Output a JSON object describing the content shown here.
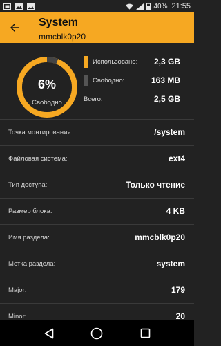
{
  "status_bar": {
    "battery": "40%",
    "time": "21:55",
    "icons": [
      "screenshot-icon",
      "gallery-icon",
      "image-icon",
      "wifi-icon",
      "signal-icon",
      "battery-icon"
    ]
  },
  "toolbar": {
    "title": "System",
    "subtitle": "mmcblk0p20",
    "back_icon": "arrow-left-icon",
    "color": "#f6a822"
  },
  "summary": {
    "used_percent": 6,
    "gauge_percent_text": "6%",
    "gauge_label": "Свободно",
    "legend": [
      {
        "label": "Использовано:",
        "value": "2,3 GB",
        "color": "#f6a822"
      },
      {
        "label": "Свободно:",
        "value": "163 MB",
        "color": "#555555"
      },
      {
        "label": "Всего:",
        "value": "2,5 GB",
        "color": ""
      }
    ]
  },
  "details": [
    {
      "key": "Точка монтирования:",
      "value": "/system"
    },
    {
      "key": "Файловая система:",
      "value": "ext4"
    },
    {
      "key": "Тип доступа:",
      "value": "Только чтение"
    },
    {
      "key": "Размер блока:",
      "value": "4 KB"
    },
    {
      "key": "Имя раздела:",
      "value": "mmcblk0p20"
    },
    {
      "key": "Метка раздела:",
      "value": "system"
    },
    {
      "key": "Major:",
      "value": "179"
    },
    {
      "key": "Minor:",
      "value": "20"
    }
  ],
  "navbar": {
    "icons": [
      "back-triangle-icon",
      "home-circle-icon",
      "recents-square-icon"
    ]
  }
}
